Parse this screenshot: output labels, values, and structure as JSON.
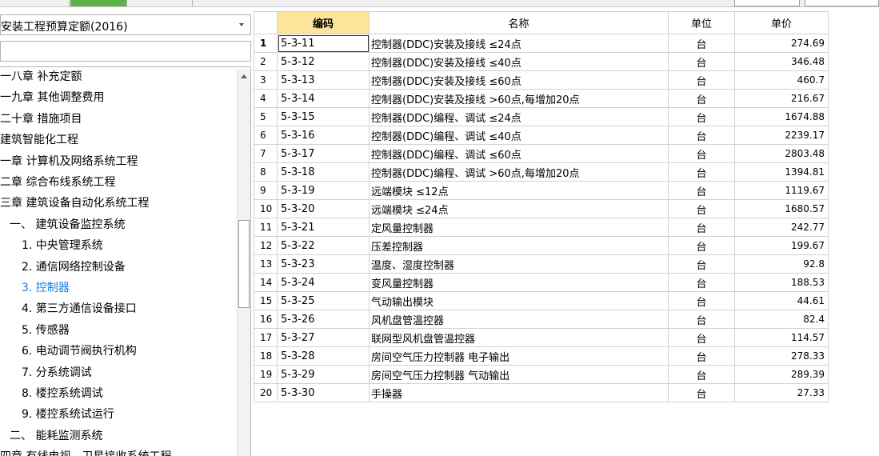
{
  "combo": {
    "value": "安装工程预算定额(2016)"
  },
  "search": {
    "placeholder": ""
  },
  "tree": [
    {
      "label": "一八章 补充定额",
      "indent": 0
    },
    {
      "label": "一九章 其他调整费用",
      "indent": 0
    },
    {
      "label": "二十章 措施项目",
      "indent": 0
    },
    {
      "label": "建筑智能化工程",
      "indent": 0
    },
    {
      "label": "一章 计算机及网络系统工程",
      "indent": 0
    },
    {
      "label": "二章 综合布线系统工程",
      "indent": 0
    },
    {
      "label": "三章 建筑设备自动化系统工程",
      "indent": 0
    },
    {
      "label": "一、 建筑设备监控系统",
      "indent": 1
    },
    {
      "label": "1. 中央管理系统",
      "indent": 2
    },
    {
      "label": "2. 通信网络控制设备",
      "indent": 2
    },
    {
      "label": "3. 控制器",
      "indent": 2,
      "selected": true
    },
    {
      "label": "4. 第三方通信设备接口",
      "indent": 2
    },
    {
      "label": "5. 传感器",
      "indent": 2
    },
    {
      "label": "6. 电动调节阀执行机构",
      "indent": 2
    },
    {
      "label": "7. 分系统调试",
      "indent": 2
    },
    {
      "label": "8. 楼控系统调试",
      "indent": 2
    },
    {
      "label": "9. 楼控系统试运行",
      "indent": 2
    },
    {
      "label": "二、 能耗监测系统",
      "indent": 1
    },
    {
      "label": "四章 有线电视、卫星接收系统工程",
      "indent": 0
    }
  ],
  "grid": {
    "headers": {
      "code": "编码",
      "name": "名称",
      "unit": "单位",
      "price": "单价"
    },
    "rows": [
      {
        "idx": "1",
        "code": "5-3-11",
        "name": "控制器(DDC)安装及接线 ≤24点",
        "unit": "台",
        "price": "274.69"
      },
      {
        "idx": "2",
        "code": "5-3-12",
        "name": "控制器(DDC)安装及接线 ≤40点",
        "unit": "台",
        "price": "346.48"
      },
      {
        "idx": "3",
        "code": "5-3-13",
        "name": "控制器(DDC)安装及接线 ≤60点",
        "unit": "台",
        "price": "460.7"
      },
      {
        "idx": "4",
        "code": "5-3-14",
        "name": "控制器(DDC)安装及接线 >60点,每增加20点",
        "unit": "台",
        "price": "216.67"
      },
      {
        "idx": "5",
        "code": "5-3-15",
        "name": "控制器(DDC)编程、调试 ≤24点",
        "unit": "台",
        "price": "1674.88"
      },
      {
        "idx": "6",
        "code": "5-3-16",
        "name": "控制器(DDC)编程、调试 ≤40点",
        "unit": "台",
        "price": "2239.17"
      },
      {
        "idx": "7",
        "code": "5-3-17",
        "name": "控制器(DDC)编程、调试 ≤60点",
        "unit": "台",
        "price": "2803.48"
      },
      {
        "idx": "8",
        "code": "5-3-18",
        "name": "控制器(DDC)编程、调试 >60点,每增加20点",
        "unit": "台",
        "price": "1394.81"
      },
      {
        "idx": "9",
        "code": "5-3-19",
        "name": "远端模块 ≤12点",
        "unit": "台",
        "price": "1119.67"
      },
      {
        "idx": "10",
        "code": "5-3-20",
        "name": "远端模块 ≤24点",
        "unit": "台",
        "price": "1680.57"
      },
      {
        "idx": "11",
        "code": "5-3-21",
        "name": "定风量控制器",
        "unit": "台",
        "price": "242.77"
      },
      {
        "idx": "12",
        "code": "5-3-22",
        "name": "压差控制器",
        "unit": "台",
        "price": "199.67"
      },
      {
        "idx": "13",
        "code": "5-3-23",
        "name": "温度、湿度控制器",
        "unit": "台",
        "price": "92.8"
      },
      {
        "idx": "14",
        "code": "5-3-24",
        "name": "变风量控制器",
        "unit": "台",
        "price": "188.53"
      },
      {
        "idx": "15",
        "code": "5-3-25",
        "name": "气动输出模块",
        "unit": "台",
        "price": "44.61"
      },
      {
        "idx": "16",
        "code": "5-3-26",
        "name": "风机盘管温控器",
        "unit": "台",
        "price": "82.4"
      },
      {
        "idx": "17",
        "code": "5-3-27",
        "name": "联网型风机盘管温控器",
        "unit": "台",
        "price": "114.57"
      },
      {
        "idx": "18",
        "code": "5-3-28",
        "name": "房间空气压力控制器 电子输出",
        "unit": "台",
        "price": "278.33"
      },
      {
        "idx": "19",
        "code": "5-3-29",
        "name": "房间空气压力控制器 气动输出",
        "unit": "台",
        "price": "289.39"
      },
      {
        "idx": "20",
        "code": "5-3-30",
        "name": "手操器",
        "unit": "台",
        "price": "27.33"
      }
    ]
  },
  "colors": {
    "header_highlight": "#fce59a",
    "selected_tree": "#1a7ce0",
    "tab_green": "#5fb14a"
  }
}
